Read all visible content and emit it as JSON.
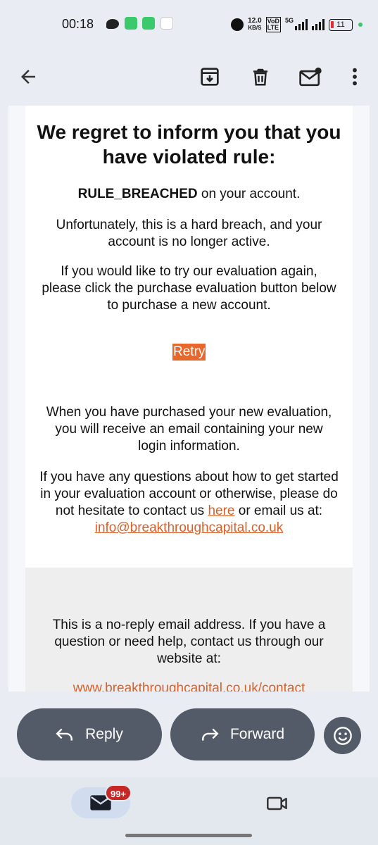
{
  "status_bar": {
    "time": "00:18",
    "network_speed": "12.0",
    "network_speed_unit": "KB/S",
    "volte_top": "VoD",
    "volte_bottom": "LTE",
    "network_type": "5G",
    "battery": "11"
  },
  "toolbar": {
    "back_icon": "arrow-left-icon",
    "archive_icon": "archive-icon",
    "delete_icon": "trash-icon",
    "unread_icon": "mark-unread-icon",
    "more_icon": "more-vert-icon"
  },
  "email": {
    "headline": "We regret to inform you that you have violated rule:",
    "rule_code": "RULE_BREACHED",
    "rule_suffix": " on your account.",
    "hard_breach_text": "Unfortunately, this is a hard breach, and your account is no longer active.",
    "retry_prompt": "If you would like to try our evaluation again, please click the purchase evaluation button below to purchase a new account.",
    "retry_label": "Retry",
    "purchase_info": "When you have purchased your new evaluation, you will receive an email containing your new login information.",
    "questions_prefix": "If you have any questions about how to get started in your evaluation account or otherwise, please do not hesitate to contact us ",
    "here_link": "here",
    "questions_middle": " or email us at:",
    "email_link": "info@breakthroughcapital.co.uk",
    "footer_text": "This is a no-reply email address. If you have a question or need help, contact us through our website at:",
    "footer_link": "www.breakthroughcapital.co.uk/contact"
  },
  "actions": {
    "reply_label": "Reply",
    "forward_label": "Forward",
    "emoji_icon": "smiley-icon"
  },
  "bottom_nav": {
    "mail_badge": "99+",
    "mail_icon": "mail-icon",
    "meet_icon": "video-camera-icon"
  },
  "colors": {
    "accent": "#e8672a",
    "link": "#d9602a",
    "pill": "#545b68",
    "badge": "#c62828",
    "background": "#e9edf3"
  }
}
